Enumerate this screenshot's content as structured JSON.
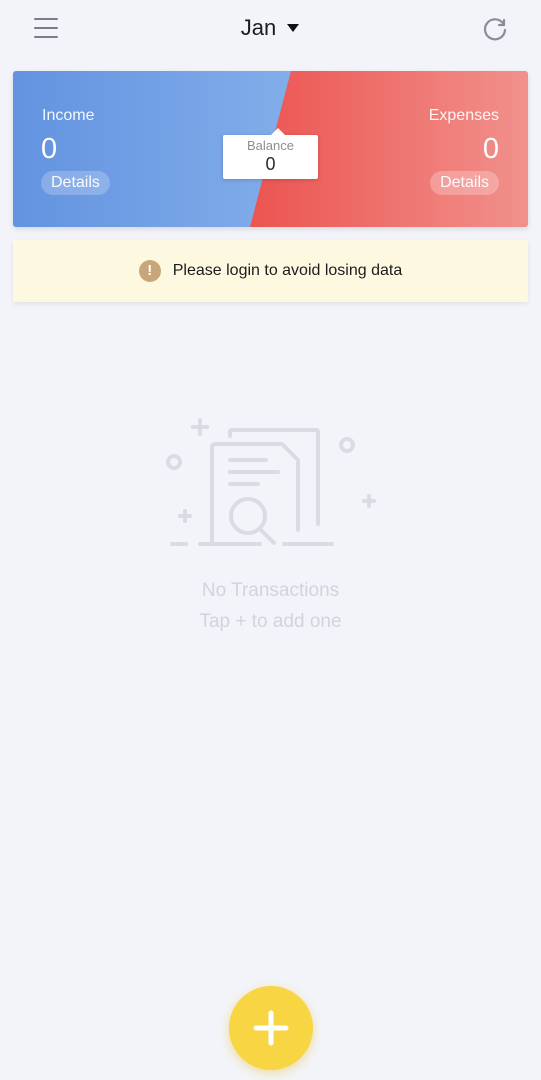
{
  "header": {
    "month": "Jan"
  },
  "summary": {
    "income_label": "Income",
    "income_value": "0",
    "income_details": "Details",
    "expenses_label": "Expenses",
    "expenses_value": "0",
    "expenses_details": "Details",
    "balance_label": "Balance",
    "balance_value": "0"
  },
  "banner": {
    "icon": "!",
    "text": "Please login to avoid losing data"
  },
  "empty_state": {
    "title": "No Transactions",
    "hint": "Tap + to add one"
  },
  "icons": {
    "menu": "hamburger-menu-icon",
    "month_dropdown": "caret-down-icon",
    "refresh": "refresh-icon",
    "warning": "exclamation-circle-icon",
    "empty": "document-search-icon",
    "add": "plus-icon"
  },
  "colors": {
    "income_gradient_start": "#6393e0",
    "income_gradient_end": "#98c1f1",
    "expenses_gradient_start": "#ed5a55",
    "expenses_gradient_end": "#f08f8a",
    "banner_bg": "#fdf9e1",
    "warning_icon": "#c9a67a",
    "fab": "#f8d542",
    "background": "#f3f4f9"
  }
}
